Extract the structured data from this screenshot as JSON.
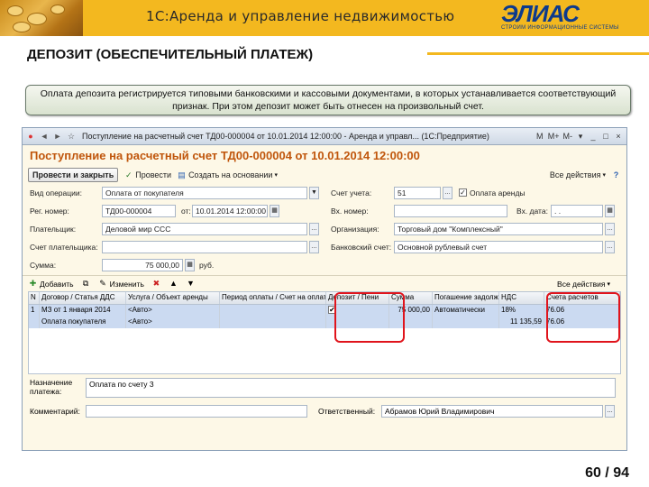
{
  "slide": {
    "header_title": "1С:Аренда и управление недвижимостью",
    "logo_text": "ЭЛИАС",
    "logo_tagline": "СТРОИМ ИНФОРМАЦИОННЫЕ СИСТЕМЫ",
    "section_title": "ДЕПОЗИТ (ОБЕСПЕЧИТЕЛЬНЫЙ ПЛАТЕЖ)",
    "callout": "Оплата депозита регистрируется типовыми банковскими и кассовыми документами, в которых устанавливается соответствующий признак. При этом депозит может быть отнесен на произвольный счет.",
    "page": "60 / 94",
    "accent_color": "#f3b81f",
    "highlight_color": "#e0141c"
  },
  "window": {
    "title": "Поступление на расчетный счет ТД00-000004 от 10.01.2014 12:00:00 - Аренда и управл... (1С:Предприятие)",
    "controls": [
      "M",
      "M+",
      "M-",
      "▾",
      "_",
      "□",
      "×"
    ]
  },
  "doc": {
    "title": "Поступление на расчетный счет ТД00-000004 от 10.01.2014 12:00:00",
    "toolbar": {
      "post_close": "Провести и закрыть",
      "post": "Провести",
      "create_based": "Создать на основании",
      "actions": "Все действия",
      "help": "?"
    }
  },
  "form": {
    "op_type_label": "Вид операции:",
    "op_type_value": "Оплата от покупателя",
    "account_label": "Счет учета:",
    "account_value": "51",
    "rent_payment_label": "Оплата аренды",
    "reg_no_label": "Рег. номер:",
    "reg_no_value": "ТД00-000004",
    "date_label": "от:",
    "date_value": "10.01.2014 12:00:00",
    "in_no_label": "Вх. номер:",
    "in_no_value": "",
    "in_date_label": "Вх. дата:",
    "in_date_value": ". .",
    "payer_label": "Плательщик:",
    "payer_value": "Деловой мир ССС",
    "org_label": "Организация:",
    "org_value": "Торговый дом \"Комплексный\"",
    "payer_acc_label": "Счет плательщика:",
    "payer_acc_value": "",
    "bank_acc_label": "Банковский счет:",
    "bank_acc_value": "Основной рублевый счет",
    "sum_label": "Сумма:",
    "sum_value": "75 000,00",
    "currency": "руб."
  },
  "table": {
    "toolbar": {
      "add": "Добавить",
      "change": "Изменить",
      "actions": "Все действия"
    },
    "columns": [
      "N",
      "Договор / Статья ДДС",
      "Услуга / Объект аренды",
      "Период оплаты / Счет на оплату",
      "Депозит / Пени",
      "Сумма",
      "Погашение задолж.",
      "НДС",
      "Счета расчетов"
    ],
    "rows": [
      {
        "n": "1",
        "c1": "МЗ от 1 января 2014",
        "c1b": "Оплата покупателя",
        "c2": "<Авто>",
        "c2b": "<Авто>",
        "c3": "",
        "c4": "✔",
        "c5": "75 000,00",
        "c6": "Автоматически",
        "c7": "18%",
        "c7b": "11 135,59",
        "c8": "76.06",
        "c8b": "76.06"
      }
    ]
  },
  "bottom": {
    "purpose_label": "Назначение платежа:",
    "purpose_value": "Оплата по счету 3",
    "comment_label": "Комментарий:",
    "comment_value": "",
    "responsible_label": "Ответственный:",
    "responsible_value": "Абрамов Юрий Владимирович"
  }
}
